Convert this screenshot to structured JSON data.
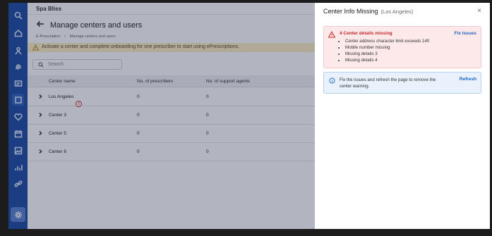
{
  "app": {
    "name": "Spa Bliss"
  },
  "page": {
    "title": "Manage centers and users"
  },
  "breadcrumb": {
    "item1": "E-Prescription",
    "item2": "Manage centers and users"
  },
  "warning": {
    "text": "Activate a center and complete onboarding for one prescriber to start using ePrescriptions."
  },
  "search": {
    "placeholder": "Search"
  },
  "table": {
    "headers": [
      "Center name",
      "No. of prescribers",
      "No. of support agents"
    ],
    "rows": [
      {
        "name": "Los Angeles",
        "prescribers": "0",
        "agents": "0",
        "alert": "!"
      },
      {
        "name": "Center 3",
        "prescribers": "0",
        "agents": "0"
      },
      {
        "name": "Center 5",
        "prescribers": "0",
        "agents": "0"
      },
      {
        "name": "Center 8",
        "prescribers": "0",
        "agents": "0"
      }
    ]
  },
  "panel": {
    "title": "Center Info Missing",
    "subtitle": "(Los Angeles)",
    "close": "×",
    "error": {
      "title": "4 Center details missing",
      "link": "Fix Issues",
      "items": [
        "Center address character limit exceeds 140",
        "Mobile number missing",
        "Missing details 3",
        "Missing details 4"
      ]
    },
    "info": {
      "text": "Fix the issues and refresh the page to remove the center warning.",
      "link": "Refresh"
    }
  },
  "colors": {
    "sidebar": "#1d4fa3",
    "error": "#c62828",
    "link": "#1d64c9",
    "warning_bg": "#fdf0c7"
  },
  "sidebar_icons": [
    "search-icon",
    "home-icon",
    "people-icon",
    "fingerprint-icon",
    "message-icon",
    "grid-icon",
    "heart-icon",
    "calendar-icon",
    "image-icon",
    "chart-icon",
    "link-icon",
    "settings-icon"
  ]
}
